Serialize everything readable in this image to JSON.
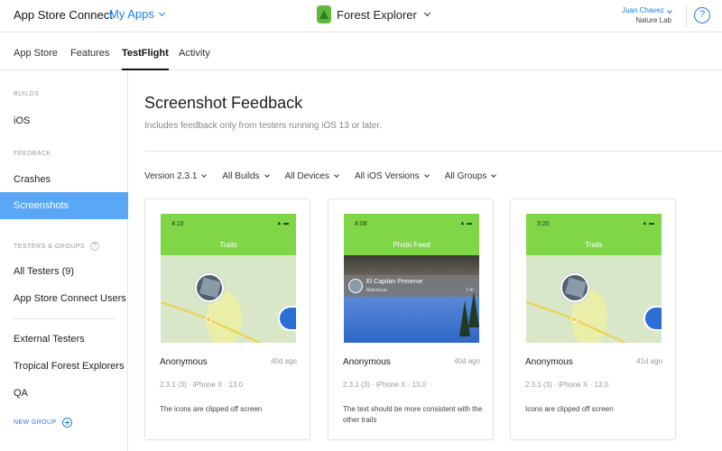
{
  "topbar": {
    "brand": "App Store Connect",
    "my_apps": "My Apps",
    "app_name": "Forest Explorer",
    "user_name": "Juan Chavez",
    "user_org": "Nature Lab",
    "help": "?",
    "icons": [
      "chevron-down-icon",
      "app-icon",
      "help-icon"
    ]
  },
  "tabs": [
    {
      "label": "App Store"
    },
    {
      "label": "Features"
    },
    {
      "label": "TestFlight"
    },
    {
      "label": "Activity"
    }
  ],
  "sidebar": {
    "builds_header": "BUILDS",
    "builds_item": "iOS",
    "feedback_header": "FEEDBACK",
    "crashes": "Crashes",
    "screenshots": "Screenshots",
    "testers_header": "TESTERS & GROUPS",
    "help_badge": "?",
    "all_testers": "All Testers (9)",
    "asc_users": "App Store Connect Users",
    "external": "External Testers",
    "group_tropical": "Tropical Forest Explorers",
    "group_qa": "QA",
    "new_group": "NEW GROUP"
  },
  "main": {
    "title": "Screenshot Feedback",
    "subtitle": "Includes feedback only from testers running iOS 13 or later.",
    "filters": [
      {
        "label": "Version 2.3.1"
      },
      {
        "label": "All Builds"
      },
      {
        "label": "All Devices"
      },
      {
        "label": "All iOS Versions"
      },
      {
        "label": "All Groups"
      }
    ]
  },
  "cards": [
    {
      "time": "4:10",
      "screen_title": "Trails",
      "tester": "Anonymous",
      "ago": "40d ago",
      "meta": "2.3.1 (3) · iPhone X · 13.0",
      "comment": "The icons are clipped off screen"
    },
    {
      "time": "4:08",
      "screen_title": "Photo Feed",
      "photo_place": "El Capitan Preserve",
      "photo_user": "Malonicus",
      "photo_time": "1 hr",
      "tester": "Anonymous",
      "ago": "40d ago",
      "meta": "2.3.1 (3) · iPhone X · 13.0",
      "comment": "The text should be more consistent with the other trails"
    },
    {
      "time": "3:20",
      "screen_title": "Trails",
      "tester": "Anonymous",
      "ago": "41d ago",
      "meta": "2.3.1 (3) · iPhone X · 13.0",
      "comment": "Icons are clipped off screen"
    }
  ],
  "colors": {
    "accent": "#1c7ef0",
    "sidebar_active": "#5aa7f6",
    "app_green": "#7fd647"
  }
}
